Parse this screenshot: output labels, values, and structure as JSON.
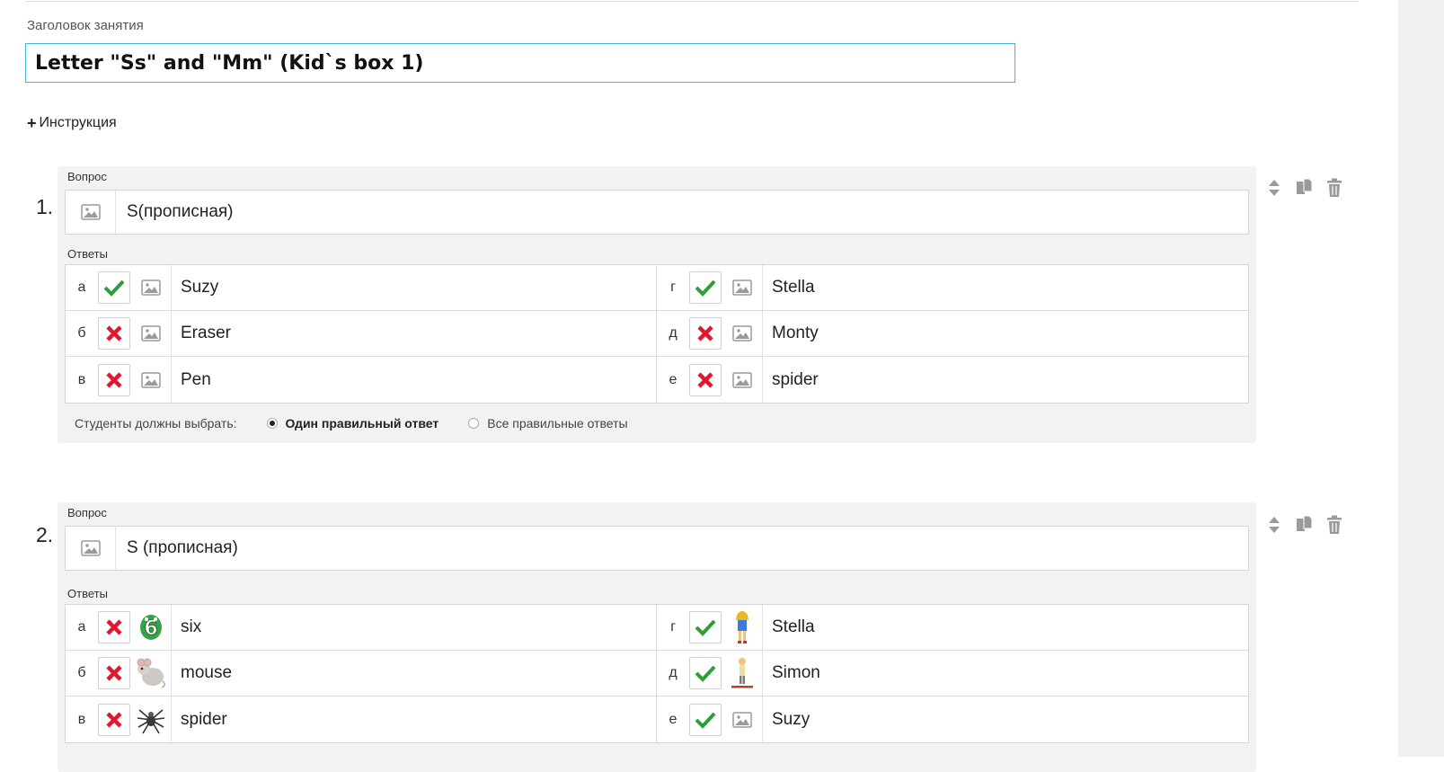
{
  "lesson": {
    "title_label": "Заголовок занятия",
    "title_value": "Letter \"Ss\" and \"Mm\" (Kid`s box 1)"
  },
  "instruction": {
    "label": "Инструкция"
  },
  "labels": {
    "question": "Вопрос",
    "answers": "Ответы",
    "students_choose": "Студенты должны выбрать:",
    "one_correct": "Один правильный ответ",
    "all_correct": "Все правильные ответы"
  },
  "questions": [
    {
      "number": "1.",
      "text": "S(прописная)",
      "mode": "one",
      "answers": [
        {
          "letter": "а",
          "text": "Suzy",
          "correct": true,
          "picture": "image-placeholder-icon"
        },
        {
          "letter": "г",
          "text": "Stella",
          "correct": true,
          "picture": "image-placeholder-icon"
        },
        {
          "letter": "б",
          "text": "Eraser",
          "correct": false,
          "picture": "image-placeholder-icon"
        },
        {
          "letter": "д",
          "text": "Monty",
          "correct": false,
          "picture": "image-placeholder-icon"
        },
        {
          "letter": "в",
          "text": "Pen",
          "correct": false,
          "picture": "image-placeholder-icon"
        },
        {
          "letter": "е",
          "text": "spider",
          "correct": false,
          "picture": "image-placeholder-icon"
        }
      ]
    },
    {
      "number": "2.",
      "text": "S (прописная)",
      "answers": [
        {
          "letter": "а",
          "text": "six",
          "correct": false,
          "picture": "six-icon"
        },
        {
          "letter": "г",
          "text": "Stella",
          "correct": true,
          "picture": "girl-icon"
        },
        {
          "letter": "б",
          "text": "mouse",
          "correct": false,
          "picture": "mouse-icon"
        },
        {
          "letter": "д",
          "text": "Simon",
          "correct": true,
          "picture": "boy-icon"
        },
        {
          "letter": "в",
          "text": "spider",
          "correct": false,
          "picture": "spider-icon"
        },
        {
          "letter": "е",
          "text": "Suzy",
          "correct": true,
          "picture": "image-placeholder-icon"
        }
      ]
    }
  ],
  "colors": {
    "correct": "#2e9e3a",
    "wrong": "#e0182d",
    "focus_border": "#45b5da",
    "panel_bg": "#f2f2f2"
  }
}
